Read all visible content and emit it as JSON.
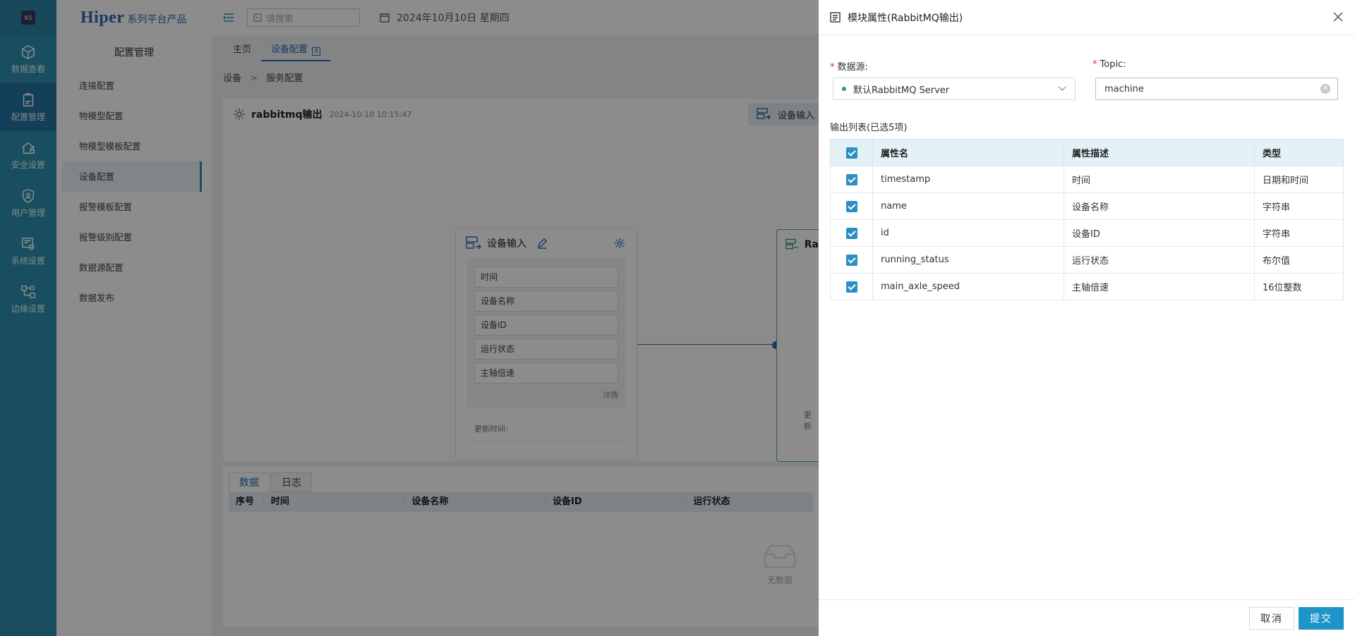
{
  "rail": {
    "logo_text": "KS",
    "items": [
      {
        "label": "数据查看",
        "icon": "cube-icon"
      },
      {
        "label": "配置管理",
        "icon": "clipboard-icon",
        "active": true
      },
      {
        "label": "安全设置",
        "icon": "house-lock-icon"
      },
      {
        "label": "用户管理",
        "icon": "shield-user-icon"
      },
      {
        "label": "系统设置",
        "icon": "system-gear-icon"
      },
      {
        "label": "边缘设置",
        "icon": "nodes-icon"
      }
    ]
  },
  "sidebar": {
    "brand_main": "Hiper",
    "brand_sub": "系列平台产品",
    "title": "配置管理",
    "items": [
      {
        "label": "连接配置"
      },
      {
        "label": "物模型配置"
      },
      {
        "label": "物模型模板配置"
      },
      {
        "label": "设备配置",
        "active": true
      },
      {
        "label": "报警模板配置"
      },
      {
        "label": "报警级别配置"
      },
      {
        "label": "数据源配置"
      },
      {
        "label": "数据发布"
      }
    ]
  },
  "topbar": {
    "search_placeholder": "请搜索",
    "date": "2024年10月10日 星期四"
  },
  "tabs": [
    {
      "label": "主页"
    },
    {
      "label": "设备配置",
      "active": true,
      "close": "X"
    }
  ],
  "breadcrumb": {
    "first": "设备",
    "sep": ">",
    "second": "服务配置"
  },
  "canvas": {
    "title": "rabbitmq输出",
    "time": "2024-10-10 10:15:47",
    "device_input_button": "设备输入",
    "node": {
      "title": "设备输入",
      "fields": [
        "时间",
        "设备名称",
        "设备ID",
        "运行状态",
        "主轴倍速"
      ],
      "more": "详情",
      "update_label": "更新时间:"
    },
    "node2": {
      "title": "Ra",
      "update_label": "更新"
    }
  },
  "data_panel": {
    "tabs": [
      "数据",
      "日志"
    ],
    "columns": [
      "序号",
      "时间",
      "设备名称",
      "设备ID",
      "运行状态"
    ],
    "empty": "无数据"
  },
  "drawer": {
    "title": "模块属性(RabbitMQ输出)",
    "datasource_label": "数据源:",
    "datasource_value": "默认RabbitMQ Server",
    "topic_label": "Topic:",
    "topic_value": "machine",
    "list_label": "输出列表(已选5项)",
    "columns": [
      "属性名",
      "属性描述",
      "类型"
    ],
    "rows": [
      {
        "name": "timestamp",
        "desc": "时间",
        "type": "日期和时间"
      },
      {
        "name": "name",
        "desc": "设备名称",
        "type": "字符串"
      },
      {
        "name": "id",
        "desc": "设备ID",
        "type": "字符串"
      },
      {
        "name": "running_status",
        "desc": "运行状态",
        "type": "布尔值"
      },
      {
        "name": "main_axle_speed",
        "desc": "主轴倍速",
        "type": "16位整数"
      }
    ],
    "cancel": "取消",
    "submit": "提交"
  },
  "colors": {
    "rail": "#2e8fb1",
    "accent": "#1f94c9",
    "brand": "#2e6bb5"
  }
}
